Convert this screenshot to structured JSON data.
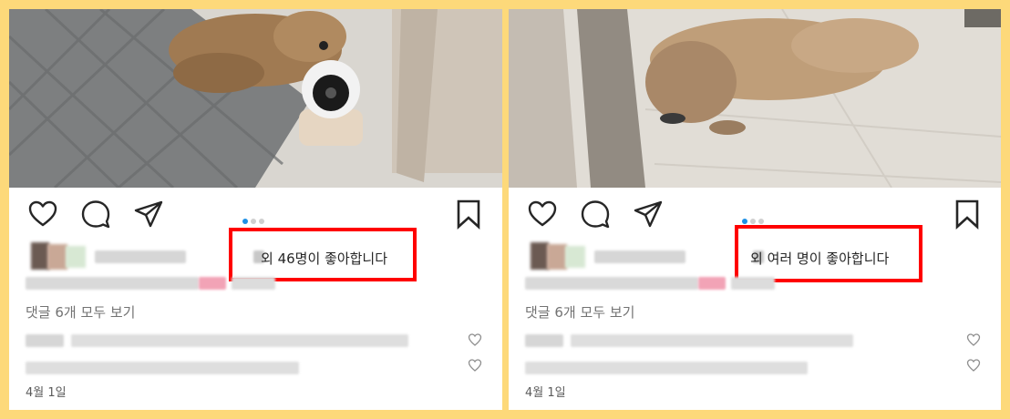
{
  "posts": [
    {
      "liked_by_suffix": "외 46명이 좋아합니다",
      "view_all_comments": "댓글 6개 모두 보기",
      "date": "4월 1일"
    },
    {
      "liked_by_suffix": "외 여러 명이 좋아합니다",
      "view_all_comments": "댓글 6개 모두 보기",
      "date": "4월 1일"
    }
  ],
  "icons": {
    "like": "heart-icon",
    "comment": "comment-bubble-icon",
    "share": "send-icon",
    "save": "bookmark-icon"
  },
  "colors": {
    "frame_background": "#fdd97a",
    "highlight_border": "#ff0000",
    "carousel_dot_active": "#1e90e6"
  }
}
